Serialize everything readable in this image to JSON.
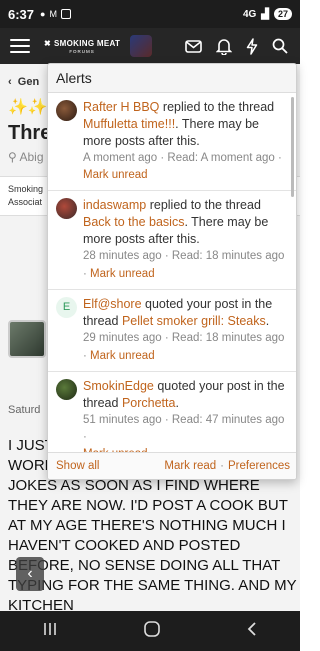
{
  "status_bar": {
    "time": "6:37",
    "network": "4G",
    "battery": "27"
  },
  "header": {
    "logo_text": "SMOKING MEAT",
    "logo_subtext": "FORUMS",
    "icons": [
      "menu-icon",
      "inbox-icon",
      "bell-icon",
      "bolt-icon",
      "search-icon"
    ]
  },
  "page": {
    "breadcrumb": "Gen",
    "sparkles": "✨✨",
    "thread_title": "Threa",
    "byline": "Abig",
    "tags_line1": "Smoking",
    "tags_line2": "Associat",
    "post_date": "Saturd",
    "post_body": "I JUST GETTI TEXAS. THINGS SEEM TO WORK FINE HERE, I'LL POST SOME JOKES AS SOON AS I FIND WHERE THEY ARE NOW. I'D POST A COOK BUT AT MY AGE THERE'S NOTHING MUCH I HAVEN'T COOKED AND POSTED BEFORE, NO SENSE DOING ALL THAT TYPING FOR THE SAME THING. AND MY KITCHEN"
  },
  "alerts": {
    "title": "Alerts",
    "items": [
      {
        "user": "Rafter H BBQ",
        "action": "replied to the thread",
        "thread": "Muffuletta time!!!",
        "suffix": ". There may be more posts after this.",
        "time": "A moment ago",
        "read": "Read: A moment ago",
        "mark": "Mark unread"
      },
      {
        "user": "indaswamp",
        "action": "replied to the thread",
        "thread": "Back to the basics",
        "suffix": ". There may be more posts after this.",
        "time": "28 minutes ago",
        "read": "Read: 18 minutes ago",
        "mark": "Mark unread"
      },
      {
        "user": "Elf@shore",
        "avatar_letter": "E",
        "action": "quoted your post in the thread",
        "thread": "Pellet smoker grill: Steaks",
        "suffix": ".",
        "time": "29 minutes ago",
        "read": "Read: 18 minutes ago",
        "mark": "Mark unread"
      },
      {
        "user": "SmokinEdge",
        "action": "quoted your post in the thread",
        "thread": "Porchetta",
        "suffix": ".",
        "time": "51 minutes ago",
        "read": "Read: 47 minutes ago",
        "mark": "Mark unread"
      }
    ],
    "footer": {
      "show_all": "Show all",
      "mark_read": "Mark read",
      "separator": "·",
      "preferences": "Preferences"
    }
  },
  "colors": {
    "link": "#c0641d",
    "header_bg": "#262626",
    "accent_green": "#2e9a5b"
  }
}
